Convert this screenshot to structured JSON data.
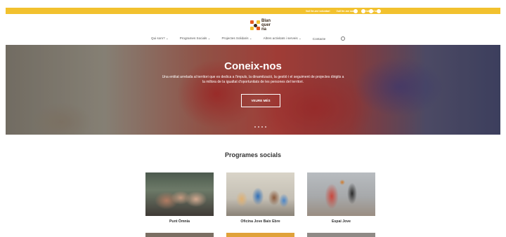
{
  "topbar": {
    "links": [
      "Vull fer-me voluntari",
      "Vull fer-me soci",
      "Col·labora'm"
    ],
    "social_icons": [
      "twitter-icon",
      "instagram-icon",
      "facebook-icon",
      "search-icon"
    ]
  },
  "logo": {
    "lines": [
      "Blan",
      "quer",
      "na"
    ]
  },
  "nav": {
    "items": [
      "Qui som? ⌄",
      "Programes Socials ⌄",
      "Projectes Solidaris ⌄",
      "Altres activitats i serveis ⌄",
      "Contacte"
    ]
  },
  "hero": {
    "title": "Coneix-nos",
    "description": "Una entitat arrelada al territori que es dedica a l'impuls, la dinamització, la gestió i el seguiment de projectes dirigits a la millora de la igualtat d'oportunitats de les persones del territori.",
    "button_label": "VEURE MÉS",
    "slide_count": 4
  },
  "programs": {
    "title": "Programes socials",
    "cards": [
      {
        "label": "Punt Òmnia"
      },
      {
        "label": "Oficina Jove Baix Ebre"
      },
      {
        "label": "Espai Jove"
      }
    ]
  },
  "colors": {
    "accent": "#f2c12e",
    "brand_dark": "#3b2a1c",
    "brand_orange": "#e45a1f"
  }
}
